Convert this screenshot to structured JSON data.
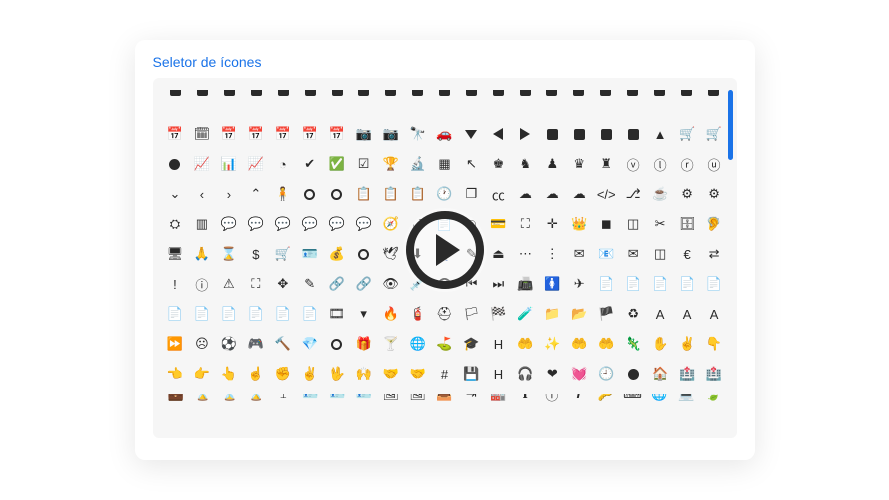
{
  "title": "Seletor de ícones",
  "colors": {
    "accent": "#1a73e8",
    "icon": "#2a2a2a",
    "panel": "#f6f6f6"
  },
  "play_button": {
    "label": "Play",
    "visible": true
  },
  "scrollbar": {
    "position": 0.04
  },
  "columns": 21,
  "rows": [
    {
      "partial": "top",
      "icons": [
        {
          "n": "icon-unknown-0"
        },
        {
          "n": "icon-unknown-1"
        },
        {
          "n": "icon-unknown-2"
        },
        {
          "n": "icon-unknown-3"
        },
        {
          "n": "icon-unknown-4"
        },
        {
          "n": "icon-unknown-5"
        },
        {
          "n": "icon-unknown-6"
        },
        {
          "n": "icon-unknown-7"
        },
        {
          "n": "icon-unknown-8"
        },
        {
          "n": "icon-unknown-9"
        },
        {
          "n": "icon-unknown-10"
        },
        {
          "n": "icon-unknown-11"
        },
        {
          "n": "icon-unknown-12"
        },
        {
          "n": "icon-unknown-13"
        },
        {
          "n": "icon-unknown-14"
        },
        {
          "n": "icon-unknown-15"
        },
        {
          "n": "icon-unknown-16"
        },
        {
          "n": "icon-unknown-17"
        },
        {
          "n": "icon-unknown-18"
        },
        {
          "n": "icon-unknown-19"
        },
        {
          "n": "icon-unknown-20"
        }
      ]
    },
    {
      "icons": [
        {
          "n": "calendar-icon",
          "g": "📅"
        },
        {
          "n": "calendar-alt-icon",
          "g": "🗓"
        },
        {
          "n": "calendar-check-icon",
          "g": "📅"
        },
        {
          "n": "calendar-minus-icon",
          "g": "📅"
        },
        {
          "n": "calendar-plus-icon",
          "g": "📅"
        },
        {
          "n": "calendar-day-icon",
          "g": "📅"
        },
        {
          "n": "calendar-week-icon",
          "g": "📅"
        },
        {
          "n": "camera-icon",
          "g": "📷"
        },
        {
          "n": "camera-retro-icon",
          "g": "📷"
        },
        {
          "n": "binoculars-icon",
          "g": "🔭"
        },
        {
          "n": "car-icon",
          "g": "🚗"
        },
        {
          "n": "caret-down-icon",
          "s": "tri-d"
        },
        {
          "n": "caret-left-icon",
          "s": "tri-l"
        },
        {
          "n": "caret-right-icon",
          "s": "tri-r"
        },
        {
          "n": "caret-square-down-icon",
          "s": "sq"
        },
        {
          "n": "caret-square-left-icon",
          "s": "sq"
        },
        {
          "n": "caret-square-right-icon",
          "s": "sq"
        },
        {
          "n": "caret-square-up-icon",
          "s": "sq"
        },
        {
          "n": "caret-up-icon",
          "g": "▲"
        },
        {
          "n": "shopping-cart-icon",
          "g": "🛒"
        },
        {
          "n": "cart-plus-icon",
          "g": "🛒"
        }
      ]
    },
    {
      "icons": [
        {
          "n": "circle-icon",
          "s": "dot"
        },
        {
          "n": "chart-area-icon",
          "g": "📈"
        },
        {
          "n": "chart-bar-icon",
          "g": "📊"
        },
        {
          "n": "chart-line-icon",
          "g": "📈"
        },
        {
          "n": "chart-pie-icon",
          "g": "◔"
        },
        {
          "n": "check-icon",
          "g": "✔"
        },
        {
          "n": "check-circle-icon",
          "g": "✅"
        },
        {
          "n": "check-square-icon",
          "g": "☑"
        },
        {
          "n": "trophy-icon",
          "g": "🏆"
        },
        {
          "n": "microscope-icon",
          "g": "🔬"
        },
        {
          "n": "chess-board-icon",
          "g": "▦"
        },
        {
          "n": "cursor-icon",
          "g": "↖"
        },
        {
          "n": "chess-king-icon",
          "g": "♚"
        },
        {
          "n": "chess-knight-icon",
          "g": "♞"
        },
        {
          "n": "chess-pawn-icon",
          "g": "♟"
        },
        {
          "n": "chess-queen-icon",
          "g": "♛"
        },
        {
          "n": "chess-rook-icon",
          "g": "♜"
        },
        {
          "n": "chevron-circle-down-icon",
          "g": "ⓥ"
        },
        {
          "n": "chevron-circle-left-icon",
          "g": "ⓛ"
        },
        {
          "n": "chevron-circle-right-icon",
          "g": "ⓡ"
        },
        {
          "n": "chevron-circle-up-icon",
          "g": "ⓤ"
        }
      ]
    },
    {
      "icons": [
        {
          "n": "chevron-down-icon",
          "g": "⌄"
        },
        {
          "n": "chevron-left-icon",
          "g": "‹"
        },
        {
          "n": "chevron-right-icon",
          "g": "›"
        },
        {
          "n": "chevron-up-icon",
          "g": "⌃"
        },
        {
          "n": "child-icon",
          "g": "🧍"
        },
        {
          "n": "circle-outline-icon",
          "s": "ring"
        },
        {
          "n": "circle-notch-icon",
          "s": "ring"
        },
        {
          "n": "clipboard-icon",
          "g": "📋"
        },
        {
          "n": "clipboard-check-icon",
          "g": "📋"
        },
        {
          "n": "clipboard-list-icon",
          "g": "📋"
        },
        {
          "n": "clock-icon",
          "g": "🕐"
        },
        {
          "n": "clone-icon",
          "g": "❐"
        },
        {
          "n": "closed-captioning-icon",
          "g": "㏄"
        },
        {
          "n": "cloud-icon",
          "g": "☁"
        },
        {
          "n": "cloud-download-icon",
          "g": "☁"
        },
        {
          "n": "cloud-upload-icon",
          "g": "☁"
        },
        {
          "n": "code-icon",
          "g": "</>"
        },
        {
          "n": "code-branch-icon",
          "g": "⎇"
        },
        {
          "n": "coffee-icon",
          "g": "☕"
        },
        {
          "n": "cog-icon",
          "g": "⚙"
        },
        {
          "n": "cogs-icon",
          "g": "⚙"
        }
      ]
    },
    {
      "icons": [
        {
          "n": "sliders-icon",
          "g": "⛭"
        },
        {
          "n": "columns-icon",
          "g": "▥"
        },
        {
          "n": "comment-icon",
          "g": "💬"
        },
        {
          "n": "comment-alt-icon",
          "g": "💬"
        },
        {
          "n": "comment-dots-icon",
          "g": "💬"
        },
        {
          "n": "comments-icon",
          "g": "💬"
        },
        {
          "n": "comment-slash-icon",
          "g": "💬"
        },
        {
          "n": "comments-alt-icon",
          "g": "💬"
        },
        {
          "n": "compass-icon",
          "g": "🧭"
        },
        {
          "n": "compress-icon",
          "g": "⤢"
        },
        {
          "n": "copy-icon",
          "g": "📄"
        },
        {
          "n": "copyright-icon",
          "g": "©"
        },
        {
          "n": "credit-card-icon",
          "g": "💳"
        },
        {
          "n": "crop-icon",
          "g": "⛶"
        },
        {
          "n": "crosshairs-icon",
          "g": "✛"
        },
        {
          "n": "crown-icon",
          "g": "👑"
        },
        {
          "n": "cube-icon",
          "g": "◼"
        },
        {
          "n": "cubes-icon",
          "g": "◫"
        },
        {
          "n": "cut-icon",
          "g": "✂"
        },
        {
          "n": "database-icon",
          "g": "🗄"
        },
        {
          "n": "deaf-icon",
          "g": "🦻"
        }
      ]
    },
    {
      "icons": [
        {
          "n": "desktop-icon",
          "g": "🖥"
        },
        {
          "n": "person-pray-icon",
          "g": "🙏"
        },
        {
          "n": "hourglass-icon",
          "g": "⌛"
        },
        {
          "n": "dollar-sign-icon",
          "g": "$"
        },
        {
          "n": "dolly-icon",
          "g": "🛒"
        },
        {
          "n": "id-badge-icon",
          "g": "🪪"
        },
        {
          "n": "donate-icon",
          "g": "💰"
        },
        {
          "n": "dot-circle-icon",
          "s": "ring"
        },
        {
          "n": "dove-icon",
          "g": "🕊"
        },
        {
          "n": "download-icon",
          "g": "⬇"
        },
        {
          "n": "dumbbell-icon",
          "g": "🏋"
        },
        {
          "n": "edit-icon",
          "g": "✎"
        },
        {
          "n": "eject-icon",
          "g": "⏏"
        },
        {
          "n": "ellipsis-h-icon",
          "g": "⋯"
        },
        {
          "n": "ellipsis-v-icon",
          "g": "⋮"
        },
        {
          "n": "envelope-icon",
          "g": "✉"
        },
        {
          "n": "envelope-open-icon",
          "g": "📧"
        },
        {
          "n": "envelope-square-icon",
          "g": "✉"
        },
        {
          "n": "eraser-icon",
          "g": "◫"
        },
        {
          "n": "euro-sign-icon",
          "g": "€"
        },
        {
          "n": "exchange-icon",
          "g": "⇄"
        }
      ]
    },
    {
      "icons": [
        {
          "n": "exclamation-icon",
          "g": "!"
        },
        {
          "n": "exclamation-circle-icon",
          "g": "ⓘ"
        },
        {
          "n": "exclamation-triangle-icon",
          "g": "⚠"
        },
        {
          "n": "expand-icon",
          "g": "⛶"
        },
        {
          "n": "expand-arrows-icon",
          "g": "✥"
        },
        {
          "n": "edit-square-icon",
          "g": "✎"
        },
        {
          "n": "link-icon",
          "g": "🔗"
        },
        {
          "n": "link-square-icon",
          "g": "🔗"
        },
        {
          "n": "eye-icon",
          "g": "👁"
        },
        {
          "n": "eye-dropper-icon",
          "g": "💉"
        },
        {
          "n": "eye-slash-icon",
          "g": "👁"
        },
        {
          "n": "fast-backward-icon",
          "g": "⏮"
        },
        {
          "n": "fast-forward-icon",
          "g": "⏭"
        },
        {
          "n": "fax-icon",
          "g": "📠"
        },
        {
          "n": "female-icon",
          "g": "🚺"
        },
        {
          "n": "fighter-jet-icon",
          "g": "✈"
        },
        {
          "n": "file-icon",
          "g": "📄"
        },
        {
          "n": "file-alt-icon",
          "g": "📄"
        },
        {
          "n": "file-archive-icon",
          "g": "📄"
        },
        {
          "n": "file-audio-icon",
          "g": "📄"
        },
        {
          "n": "file-code-icon",
          "g": "📄"
        }
      ]
    },
    {
      "icons": [
        {
          "n": "file-excel-icon",
          "g": "📄"
        },
        {
          "n": "file-image-icon",
          "g": "📄"
        },
        {
          "n": "file-pdf-icon",
          "g": "📄"
        },
        {
          "n": "file-powerpoint-icon",
          "g": "📄"
        },
        {
          "n": "file-video-icon",
          "g": "📄"
        },
        {
          "n": "file-word-icon",
          "g": "📄"
        },
        {
          "n": "film-icon",
          "g": "🎞"
        },
        {
          "n": "filter-icon",
          "g": "▾"
        },
        {
          "n": "fire-icon",
          "g": "🔥"
        },
        {
          "n": "fire-extinguisher-icon",
          "g": "🧯"
        },
        {
          "n": "first-aid-icon",
          "g": "⛑"
        },
        {
          "n": "flag-icon",
          "g": "🏳"
        },
        {
          "n": "flag-checkered-icon",
          "g": "🏁"
        },
        {
          "n": "flask-icon",
          "g": "🧪"
        },
        {
          "n": "folder-icon",
          "g": "📁"
        },
        {
          "n": "folder-open-icon",
          "g": "📂"
        },
        {
          "n": "font-awesome-icon",
          "g": "🏴"
        },
        {
          "n": "recycle-icon",
          "g": "♻"
        },
        {
          "n": "font-icon",
          "g": "A"
        },
        {
          "n": "text-height-icon",
          "g": "A"
        },
        {
          "n": "text-width-icon",
          "g": "A"
        }
      ]
    },
    {
      "icons": [
        {
          "n": "forward-icon",
          "g": "⏩"
        },
        {
          "n": "frown-icon",
          "g": "☹"
        },
        {
          "n": "futbol-icon",
          "g": "⚽"
        },
        {
          "n": "gamepad-icon",
          "g": "🎮"
        },
        {
          "n": "gavel-icon",
          "g": "🔨"
        },
        {
          "n": "gem-icon",
          "g": "💎"
        },
        {
          "n": "genderless-icon",
          "s": "ring"
        },
        {
          "n": "gift-icon",
          "g": "🎁"
        },
        {
          "n": "glass-martini-icon",
          "g": "🍸"
        },
        {
          "n": "globe-icon",
          "g": "🌐"
        },
        {
          "n": "golf-ball-icon",
          "g": "⛳"
        },
        {
          "n": "graduation-cap-icon",
          "g": "🎓"
        },
        {
          "n": "h-square-icon",
          "g": "H"
        },
        {
          "n": "hand-holding-icon",
          "g": "🤲"
        },
        {
          "n": "hand-sparkles-icon",
          "g": "✨"
        },
        {
          "n": "hand-holding-heart-icon",
          "g": "🤲"
        },
        {
          "n": "hand-holding-usd-icon",
          "g": "🤲"
        },
        {
          "n": "hand-lizard-icon",
          "g": "🦎"
        },
        {
          "n": "hand-paper-icon",
          "g": "✋"
        },
        {
          "n": "hand-peace-icon",
          "g": "✌"
        },
        {
          "n": "hand-point-down-icon",
          "g": "👇"
        }
      ]
    },
    {
      "icons": [
        {
          "n": "hand-point-left-icon",
          "g": "👈"
        },
        {
          "n": "hand-point-right-icon",
          "g": "👉"
        },
        {
          "n": "hand-point-up-icon",
          "g": "👆"
        },
        {
          "n": "hand-pointer-icon",
          "g": "☝"
        },
        {
          "n": "hand-rock-icon",
          "g": "✊"
        },
        {
          "n": "hand-scissors-icon",
          "g": "✌"
        },
        {
          "n": "hand-spock-icon",
          "g": "🖖"
        },
        {
          "n": "hands-icon",
          "g": "🙌"
        },
        {
          "n": "hands-helping-icon",
          "g": "🤝"
        },
        {
          "n": "handshake-icon",
          "g": "🤝"
        },
        {
          "n": "hashtag-icon",
          "g": "#"
        },
        {
          "n": "hdd-icon",
          "g": "💾"
        },
        {
          "n": "heading-icon",
          "g": "H"
        },
        {
          "n": "headphones-icon",
          "g": "🎧"
        },
        {
          "n": "heart-icon",
          "g": "❤"
        },
        {
          "n": "heartbeat-icon",
          "g": "💓"
        },
        {
          "n": "history-icon",
          "g": "🕘"
        },
        {
          "n": "hockey-puck-icon",
          "s": "dot"
        },
        {
          "n": "home-icon",
          "g": "🏠"
        },
        {
          "n": "hospital-icon",
          "g": "🏥"
        },
        {
          "n": "hospital-alt-icon",
          "g": "🏥"
        }
      ]
    },
    {
      "partial": "bottom",
      "icons": [
        {
          "n": "briefcase-icon",
          "g": "💼"
        },
        {
          "n": "hourglass-end-icon",
          "g": "⌛"
        },
        {
          "n": "hourglass-half-icon",
          "g": "⏳"
        },
        {
          "n": "hourglass-start-icon",
          "g": "⌛"
        },
        {
          "n": "i-cursor-icon",
          "g": "𝙸"
        },
        {
          "n": "id-badge-2-icon",
          "g": "🪪"
        },
        {
          "n": "id-card-icon",
          "g": "🪪"
        },
        {
          "n": "id-card-alt-icon",
          "g": "🪪"
        },
        {
          "n": "image-icon",
          "g": "🖼"
        },
        {
          "n": "images-icon",
          "g": "🖼"
        },
        {
          "n": "inbox-icon",
          "g": "📥"
        },
        {
          "n": "indent-icon",
          "g": "⇥"
        },
        {
          "n": "industry-icon",
          "g": "🏭"
        },
        {
          "n": "info-icon",
          "g": "ℹ"
        },
        {
          "n": "info-circle-icon",
          "g": "ⓘ"
        },
        {
          "n": "italic-icon",
          "g": "𝑰"
        },
        {
          "n": "key-icon",
          "g": "🔑"
        },
        {
          "n": "keyboard-icon",
          "g": "⌨"
        },
        {
          "n": "language-icon",
          "g": "🌐"
        },
        {
          "n": "laptop-icon",
          "g": "💻"
        },
        {
          "n": "leaf-icon",
          "g": "🍃"
        }
      ]
    }
  ]
}
